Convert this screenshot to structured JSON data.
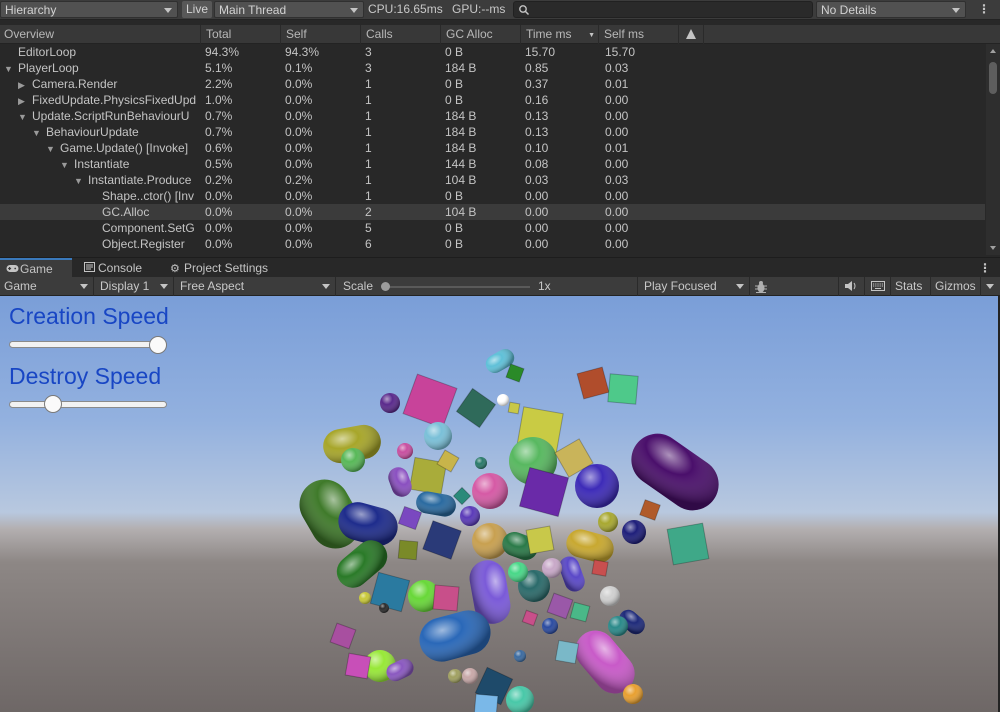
{
  "profiler_toolbar": {
    "module_label": "Hierarchy",
    "live_label": "Live",
    "thread_label": "Main Thread",
    "cpu_label": "CPU:16.65ms",
    "gpu_label": "GPU:--ms",
    "search_placeholder": "",
    "details_label": "No Details"
  },
  "columns": [
    "Overview",
    "Total",
    "Self",
    "Calls",
    "GC Alloc",
    "Time ms",
    "Self ms"
  ],
  "rows": [
    {
      "name": "EditorLoop",
      "total": "94.3%",
      "self": "94.3%",
      "calls": "3",
      "gc": "0 B",
      "time": "15.70",
      "selfms": "15.70"
    },
    {
      "name": "PlayerLoop",
      "total": "5.1%",
      "self": "0.1%",
      "calls": "3",
      "gc": "184 B",
      "time": "0.85",
      "selfms": "0.03"
    },
    {
      "name": "Camera.Render",
      "total": "2.2%",
      "self": "0.0%",
      "calls": "1",
      "gc": "0 B",
      "time": "0.37",
      "selfms": "0.01"
    },
    {
      "name": "FixedUpdate.PhysicsFixedUpd",
      "total": "1.0%",
      "self": "0.0%",
      "calls": "1",
      "gc": "0 B",
      "time": "0.16",
      "selfms": "0.00"
    },
    {
      "name": "Update.ScriptRunBehaviourU",
      "total": "0.7%",
      "self": "0.0%",
      "calls": "1",
      "gc": "184 B",
      "time": "0.13",
      "selfms": "0.00"
    },
    {
      "name": "BehaviourUpdate",
      "total": "0.7%",
      "self": "0.0%",
      "calls": "1",
      "gc": "184 B",
      "time": "0.13",
      "selfms": "0.00"
    },
    {
      "name": "Game.Update() [Invoke]",
      "total": "0.6%",
      "self": "0.0%",
      "calls": "1",
      "gc": "184 B",
      "time": "0.10",
      "selfms": "0.01"
    },
    {
      "name": "Instantiate",
      "total": "0.5%",
      "self": "0.0%",
      "calls": "1",
      "gc": "144 B",
      "time": "0.08",
      "selfms": "0.00"
    },
    {
      "name": "Instantiate.Produce",
      "total": "0.2%",
      "self": "0.2%",
      "calls": "1",
      "gc": "104 B",
      "time": "0.03",
      "selfms": "0.03"
    },
    {
      "name": "Shape..ctor() [Inv",
      "total": "0.0%",
      "self": "0.0%",
      "calls": "1",
      "gc": "0 B",
      "time": "0.00",
      "selfms": "0.00"
    },
    {
      "name": "GC.Alloc",
      "total": "0.0%",
      "self": "0.0%",
      "calls": "2",
      "gc": "104 B",
      "time": "0.00",
      "selfms": "0.00"
    },
    {
      "name": "Component.SetG",
      "total": "0.0%",
      "self": "0.0%",
      "calls": "5",
      "gc": "0 B",
      "time": "0.00",
      "selfms": "0.00"
    },
    {
      "name": "Object.Register",
      "total": "0.0%",
      "self": "0.0%",
      "calls": "6",
      "gc": "0 B",
      "time": "0.00",
      "selfms": "0.00"
    }
  ],
  "tabs": [
    {
      "label": "Game",
      "icon": "gamepad-icon"
    },
    {
      "label": "Console",
      "icon": "console-icon"
    },
    {
      "label": "Project Settings",
      "icon": "gear-icon"
    }
  ],
  "game_toolbar": {
    "view_label": "Game",
    "display_label": "Display 1",
    "aspect_label": "Free Aspect",
    "scale_label": "Scale",
    "scale_value": "1x",
    "play_mode_label": "Play Focused",
    "stats_label": "Stats",
    "gizmos_label": "Gizmos"
  },
  "game_ui": {
    "creation_label": "Creation Speed",
    "creation_value": 1.0,
    "destroy_label": "Destroy Speed",
    "destroy_value": 0.25
  }
}
